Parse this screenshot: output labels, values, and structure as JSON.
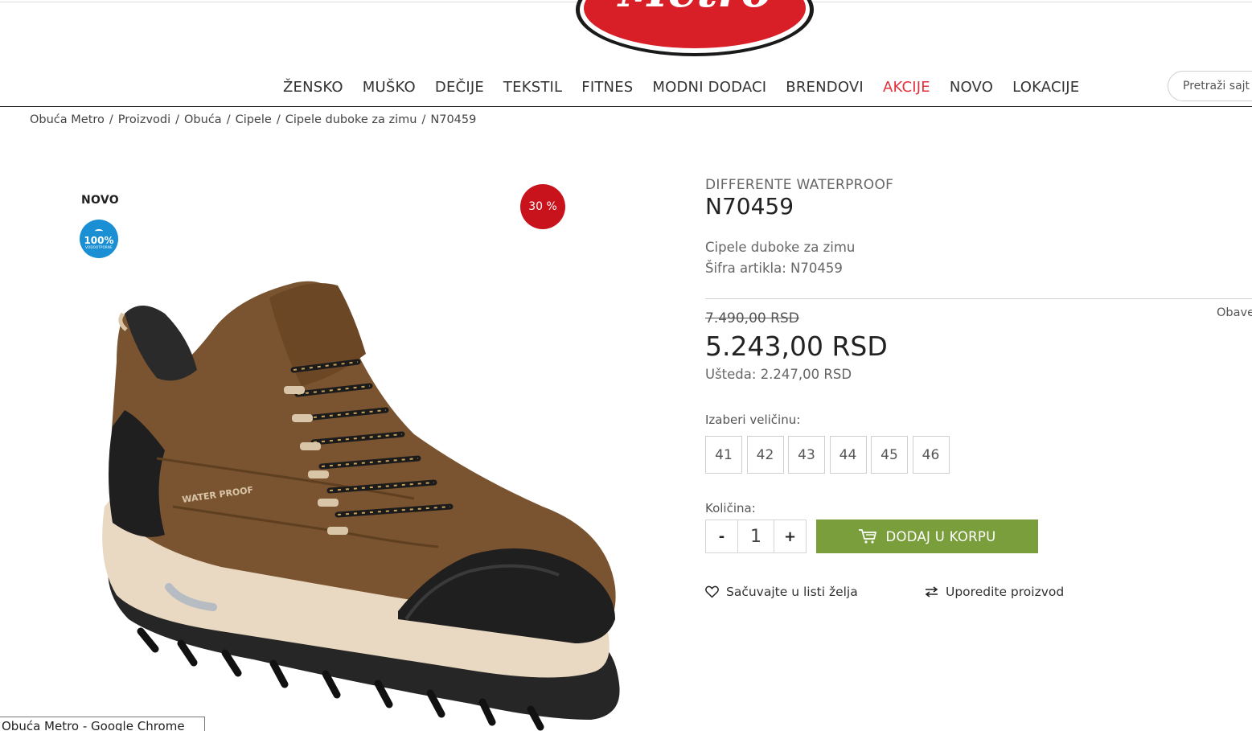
{
  "header": {
    "logo_text": "Metro",
    "nav": [
      "ŽENSKO",
      "MUŠKO",
      "DEČIJE",
      "TEKSTIL",
      "FITNES",
      "MODNI DODACI",
      "BRENDOVI",
      "AKCIJE",
      "NOVO",
      "LOKACIJE"
    ],
    "search_placeholder": "Pretraži sajt"
  },
  "breadcrumb": [
    "Obuća Metro",
    "Proizvodi",
    "Obuća",
    "Cipele",
    "Cipele duboke za zimu",
    "N70459"
  ],
  "gallery": {
    "badge_new": "NOVO",
    "badge_waterproof_pct": "100%",
    "badge_waterproof_caption": "VODOOTPORNE",
    "discount": "30 %",
    "shoe_print": "WATER PROOF"
  },
  "product": {
    "brand": "DIFFERENTE WATERPROOF",
    "code": "N70459",
    "category": "Cipele duboke za zimu",
    "sku_label": "Šifra artikla: ",
    "sku": "N70459",
    "required_note": "Obave",
    "old_price": "7.490,00 RSD",
    "price": "5.243,00 RSD",
    "saving_label": "Ušteda: ",
    "saving": "2.247,00 RSD",
    "size_label": "Izaberi veličinu:",
    "sizes": [
      "41",
      "42",
      "43",
      "44",
      "45",
      "46"
    ],
    "qty_label": "Količina:",
    "qty_minus": "-",
    "qty_value": "1",
    "qty_plus": "+",
    "add_to_cart": "DODAJ U KORPU",
    "wishlist": "Sačuvajte u listi želja",
    "compare": "Uporedite proizvod"
  },
  "colors": {
    "accent_green": "#7a9e3c",
    "sale_red": "#e3323b",
    "discount_red": "#c8121c",
    "waterproof_blue": "#1a8fd3"
  },
  "tooltip": "Obuća Metro - Google Chrome"
}
